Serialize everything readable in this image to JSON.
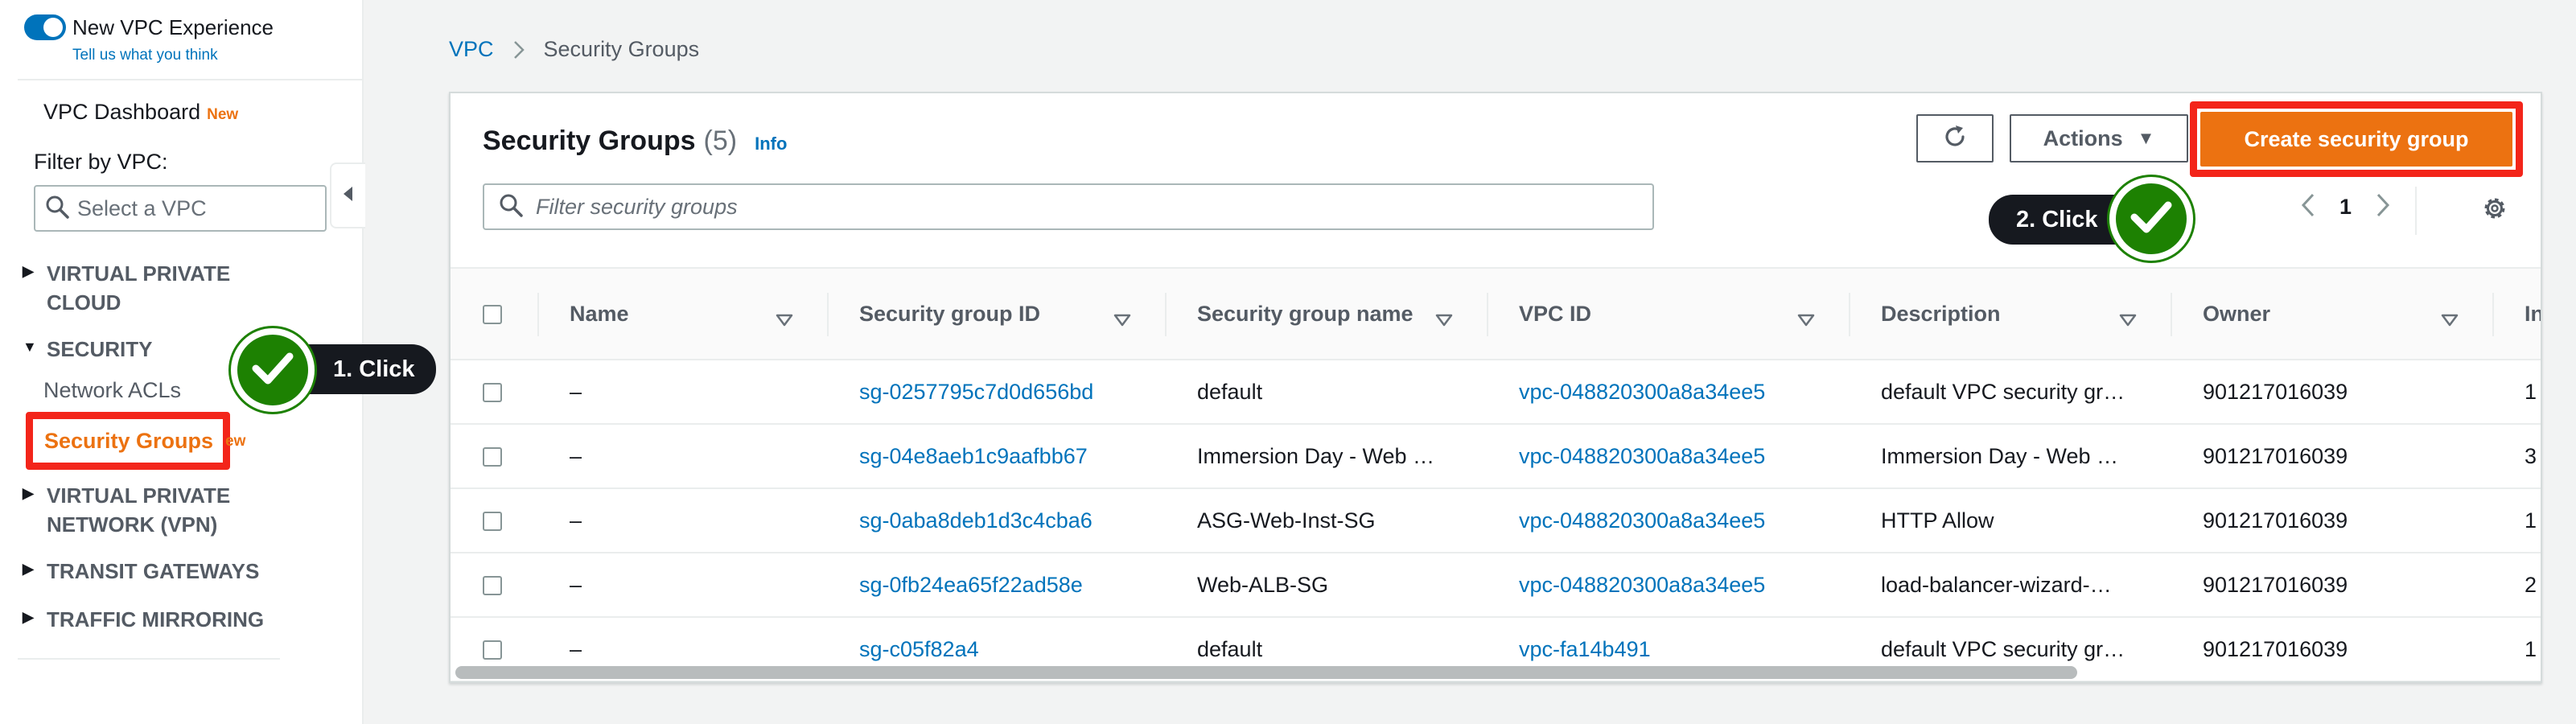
{
  "sidebar": {
    "toggle_label": "New VPC Experience",
    "feedback_link": "Tell us what you think",
    "dashboard_label": "VPC Dashboard",
    "new_badge": "New",
    "filter_label": "Filter by VPC:",
    "vpc_select_placeholder": "Select a VPC",
    "sections": {
      "virtual_private_cloud": [
        "VIRTUAL PRIVATE",
        "CLOUD"
      ],
      "security": "SECURITY",
      "vpn": [
        "VIRTUAL PRIVATE",
        "NETWORK (VPN)"
      ],
      "transit": "TRANSIT GATEWAYS",
      "mirroring": "TRAFFIC MIRRORING"
    },
    "network_acls": "Network ACLs",
    "security_groups": "Security Groups",
    "security_groups_new": "ew"
  },
  "callouts": {
    "step1": "1. Click",
    "step2": "2. Click"
  },
  "breadcrumb": {
    "root": "VPC",
    "current": "Security Groups"
  },
  "panel": {
    "title": "Security Groups",
    "count": "(5)",
    "info": "Info",
    "actions_label": "Actions",
    "create_label": "Create security group",
    "search_placeholder": "Filter security groups",
    "page": "1"
  },
  "table": {
    "headers": [
      "Name",
      "Security group ID",
      "Security group name",
      "VPC ID",
      "Description",
      "Owner",
      "In"
    ],
    "rows": [
      {
        "name": "–",
        "id": "sg-0257795c7d0d656bd",
        "group_name": "default",
        "vpc": "vpc-048820300a8a34ee5",
        "desc": "default VPC security gr…",
        "owner": "901217016039",
        "inbound": "1"
      },
      {
        "name": "–",
        "id": "sg-04e8aeb1c9aafbb67",
        "group_name": "Immersion Day - Web …",
        "vpc": "vpc-048820300a8a34ee5",
        "desc": "Immersion Day - Web …",
        "owner": "901217016039",
        "inbound": "3"
      },
      {
        "name": "–",
        "id": "sg-0aba8deb1d3c4cba6",
        "group_name": "ASG-Web-Inst-SG",
        "vpc": "vpc-048820300a8a34ee5",
        "desc": "HTTP Allow",
        "owner": "901217016039",
        "inbound": "1"
      },
      {
        "name": "–",
        "id": "sg-0fb24ea65f22ad58e",
        "group_name": "Web-ALB-SG",
        "vpc": "vpc-048820300a8a34ee5",
        "desc": "load-balancer-wizard-…",
        "owner": "901217016039",
        "inbound": "2"
      },
      {
        "name": "–",
        "id": "sg-c05f82a4",
        "group_name": "default",
        "vpc": "vpc-fa14b491",
        "desc": "default VPC security gr…",
        "owner": "901217016039",
        "inbound": "1"
      }
    ]
  },
  "colors": {
    "accent_orange": "#ec7211",
    "link_blue": "#0073bb",
    "highlight_red": "#f3251a",
    "check_green": "#1d8102"
  },
  "icons": [
    "search-icon",
    "refresh-icon",
    "caret-down-icon",
    "chevron-left-icon",
    "chevron-right-icon",
    "gear-icon",
    "filter-icon",
    "checkmark-icon",
    "collapse-icon"
  ]
}
